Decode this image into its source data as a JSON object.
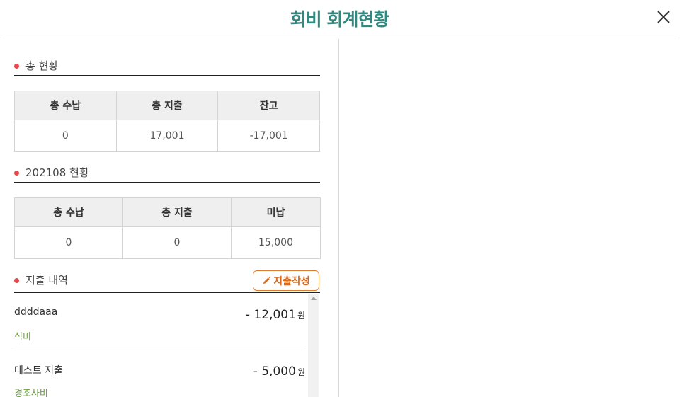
{
  "modal": {
    "title": "회비 회계현황"
  },
  "total_section": {
    "title": "총 현황",
    "headers": [
      "총 수납",
      "총 지출",
      "잔고"
    ],
    "values": [
      "0",
      "17,001",
      "-17,001"
    ]
  },
  "month_section": {
    "title": "202108 현황",
    "headers": [
      "총 수납",
      "총 지출",
      "미납"
    ],
    "values": [
      "0",
      "0",
      "15,000"
    ]
  },
  "expense_section": {
    "title": "지출 내역",
    "write_button_label": "지출작성",
    "currency": "원",
    "items": [
      {
        "name": "ddddaaa",
        "category": "식비",
        "amount": "- 12,001"
      },
      {
        "name": "테스트 지출",
        "category": "경조사비",
        "amount": "- 5,000"
      }
    ]
  },
  "colors": {
    "title": "#2e8a80",
    "dot": "#e5484d",
    "write_button": "#d96a1c",
    "category": "#6a9e3a"
  }
}
